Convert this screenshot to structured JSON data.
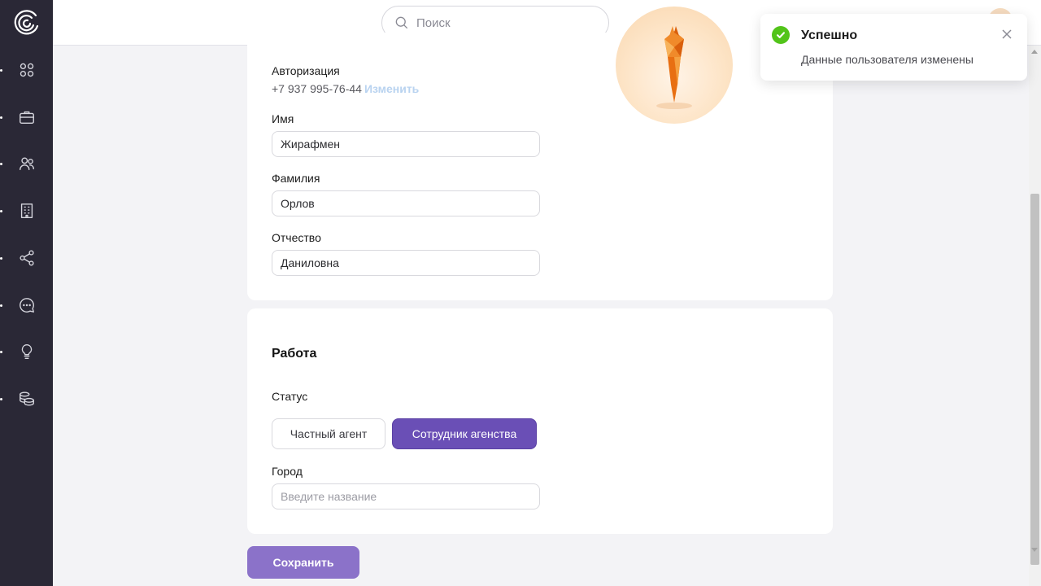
{
  "search": {
    "placeholder": "Поиск"
  },
  "personal": {
    "auth_label": "Авторизация",
    "phone": "+7 937 995-76-44",
    "change_link": "Изменить",
    "first_name_label": "Имя",
    "first_name": "Жирафмен",
    "last_name_label": "Фамилия",
    "last_name": "Орлов",
    "patronymic_label": "Отчество",
    "patronymic": "Даниловна"
  },
  "work": {
    "title": "Работа",
    "status_label": "Статус",
    "status_options": [
      "Частный агент",
      "Сотрудник агенства"
    ],
    "status_selected": "Сотрудник агенства",
    "city_label": "Город",
    "city_placeholder": "Введите название"
  },
  "actions": {
    "save": "Сохранить"
  },
  "toast": {
    "title": "Успешно",
    "message": "Данные пользователя изменены"
  },
  "sidebar": {
    "icons": [
      "dashboard-icon",
      "briefcase-icon",
      "users-icon",
      "building-icon",
      "share-icon",
      "chat-icon",
      "lightbulb-icon",
      "coins-icon"
    ]
  },
  "colors": {
    "accent": "#6a4fb6",
    "save": "#8b72c9",
    "success": "#52c41a",
    "sidebar": "#2a2836",
    "link": "#b9d3f0"
  }
}
